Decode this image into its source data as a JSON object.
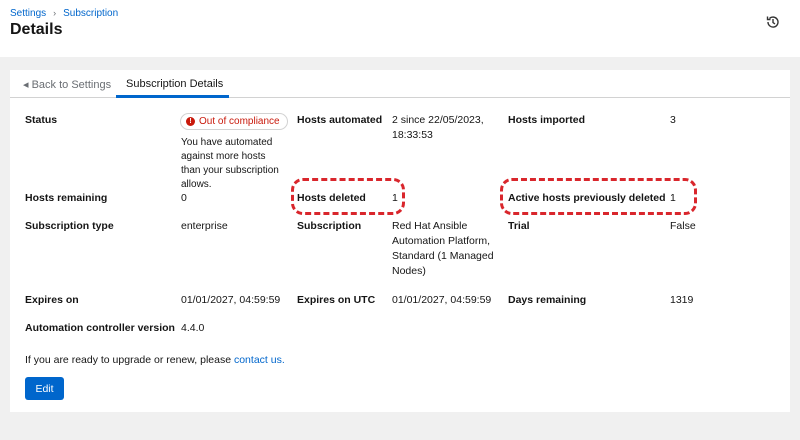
{
  "breadcrumb": {
    "items": [
      "Settings",
      "Subscription"
    ]
  },
  "page_title": "Details",
  "tabs": {
    "back": "Back to Settings",
    "active": "Subscription Details"
  },
  "fields": {
    "status": {
      "label": "Status",
      "badge": "Out of compliance",
      "note": "You have automated against more hosts than your subscription allows."
    },
    "hosts_automated": {
      "label": "Hosts automated",
      "value": "2 since 22/05/2023, 18:33:53"
    },
    "hosts_imported": {
      "label": "Hosts imported",
      "value": "3"
    },
    "hosts_remaining": {
      "label": "Hosts remaining",
      "value": "0"
    },
    "hosts_deleted": {
      "label": "Hosts deleted",
      "value": "1"
    },
    "active_prev_deleted": {
      "label": "Active hosts previously deleted",
      "value": "1"
    },
    "subscription_type": {
      "label": "Subscription type",
      "value": "enterprise"
    },
    "subscription": {
      "label": "Subscription",
      "value": "Red Hat Ansible Automation Platform, Standard (1 Managed Nodes)"
    },
    "trial": {
      "label": "Trial",
      "value": "False"
    },
    "expires_on": {
      "label": "Expires on",
      "value": "01/01/2027, 04:59:59"
    },
    "expires_utc": {
      "label": "Expires on UTC",
      "value": "01/01/2027, 04:59:59"
    },
    "days_remaining": {
      "label": "Days remaining",
      "value": "1319"
    },
    "controller_version": {
      "label": "Automation controller version",
      "value": "4.4.0"
    }
  },
  "footer": {
    "text": "If you are ready to upgrade or renew, please ",
    "link": "contact us."
  },
  "edit_label": "Edit",
  "colors": {
    "accent": "#0066cc",
    "danger": "#c9190b",
    "highlight": "#d9262c"
  }
}
